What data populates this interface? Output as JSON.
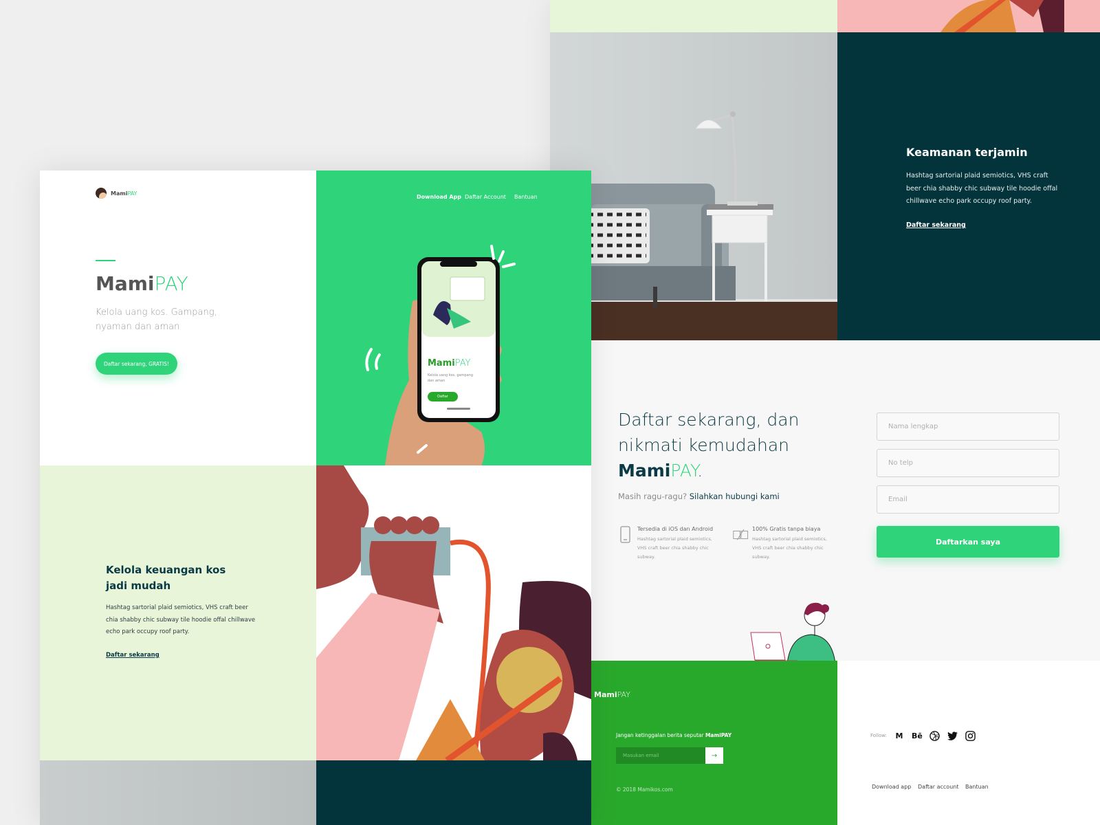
{
  "brand": {
    "mami": "Mami",
    "pay": "PAY"
  },
  "nav": {
    "download": "Download App",
    "daftar": "Daftar Account",
    "bantuan": "Bantuan"
  },
  "hero": {
    "title_mami": "Mami",
    "title_pay": "PAY",
    "subtitle": "Kelola uang kos. Gampang, nyaman dan aman",
    "cta": "Daftar sekarang, GRATIS!"
  },
  "phone": {
    "brand_mami": "Mami",
    "brand_pay": "PAY",
    "text": "Kelola uang kos, gampang dan aman",
    "button": "Daftar"
  },
  "feature1": {
    "title": "Kelola keuangan kos jadi mudah",
    "desc": "Hashtag sartorial plaid semiotics, VHS craft beer chia shabby chic subway tile hoodie offal chillwave echo park occupy roof party.",
    "link": "Daftar sekarang"
  },
  "feature2": {
    "title": "Keamanan terjamin",
    "desc": "Hashtag sartorial plaid semiotics, VHS craft beer chia shabby chic subway tile hoodie offal chillwave echo park occupy roof party.",
    "link": "Daftar sekarang"
  },
  "signup": {
    "line1": "Daftar sekarang, dan",
    "line2": "nikmati kemudahan",
    "brand_mami": "Mami",
    "brand_pay": "PAY",
    "dot": ".",
    "sub_question": "Masih ragu-ragu?",
    "sub_link": "Silahkan hubungi kami",
    "features": [
      {
        "title": "Tersedia di iOS dan Android",
        "desc": "Hashtag sartorial plaid semiotics, VHS craft beer chia shabby chic subway."
      },
      {
        "title": "100% Gratis tanpa biaya",
        "desc": "Hashtag sartorial plaid semiotics, VHS craft beer chia shabby chic subway."
      }
    ],
    "fields": {
      "name": "Nama lengkap",
      "phone": "No telp",
      "email": "Email"
    },
    "submit": "Daftarkan saya"
  },
  "footer": {
    "brand_mami": "Mami",
    "brand_pay": "PAY",
    "newsletter_text": "Jangan ketinggalan berita seputar",
    "newsletter_brand": "MamiPAY",
    "email_placeholder": "Masukan email",
    "submit_glyph": "→",
    "copyright": "© 2018 Mamikos.com",
    "follow_label": "Follow:",
    "social": [
      "medium-icon",
      "behance-icon",
      "dribbble-icon",
      "twitter-icon",
      "instagram-icon"
    ],
    "links": [
      "Download app",
      "Daftar account",
      "Bantuan"
    ]
  },
  "colors": {
    "green": "#2fd47a",
    "dark_teal": "#04343b",
    "footer_green": "#29a92c",
    "light_green": "#e8f5d8"
  }
}
